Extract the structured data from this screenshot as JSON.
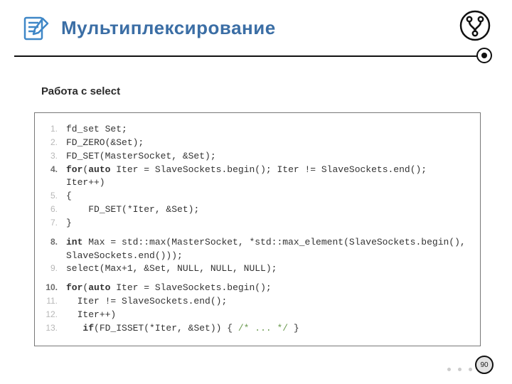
{
  "title": "Мультиплексирование",
  "subtitle": "Работа с select",
  "page_number": "90",
  "code": {
    "l1": {
      "n": "1.",
      "dark": false,
      "text": "fd_set Set;"
    },
    "l2": {
      "n": "2.",
      "dark": false,
      "text": "FD_ZERO(&Set);"
    },
    "l3": {
      "n": "3.",
      "dark": false,
      "text": "FD_SET(MasterSocket, &Set);"
    },
    "l4": {
      "n": "4.",
      "dark": true,
      "kw1": "for",
      "mid1": "(",
      "kw2": "auto",
      "rest": " Iter = SlaveSockets.begin(); Iter != SlaveSockets.end(); Iter++)"
    },
    "l5": {
      "n": "5.",
      "dark": false,
      "text": "{"
    },
    "l6": {
      "n": "6.",
      "dark": false,
      "text": "    FD_SET(*Iter, &Set);"
    },
    "l7": {
      "n": "7.",
      "dark": false,
      "text": "}"
    },
    "l8": {
      "n": "8.",
      "dark": true,
      "kw1": "int",
      "rest": " Max = std::max(MasterSocket, *std::max_element(SlaveSockets.begin(), SlaveSockets.end()));"
    },
    "l9": {
      "n": "9.",
      "dark": false,
      "text": "select(Max+1, &Set, NULL, NULL, NULL);"
    },
    "l10": {
      "n": "10.",
      "dark": true,
      "kw1": "for",
      "mid1": "(",
      "kw2": "auto",
      "rest": " Iter = SlaveSockets.begin();"
    },
    "l11": {
      "n": "11.",
      "dark": false,
      "text": "  Iter != SlaveSockets.end();"
    },
    "l12": {
      "n": "12.",
      "dark": false,
      "text": "  Iter++)"
    },
    "l13": {
      "n": "13.",
      "dark": false,
      "pre": "   ",
      "kw1": "if",
      "mid": "(FD_ISSET(*Iter, &Set)) { ",
      "cmt": "/* ... */",
      "post": " }"
    }
  }
}
